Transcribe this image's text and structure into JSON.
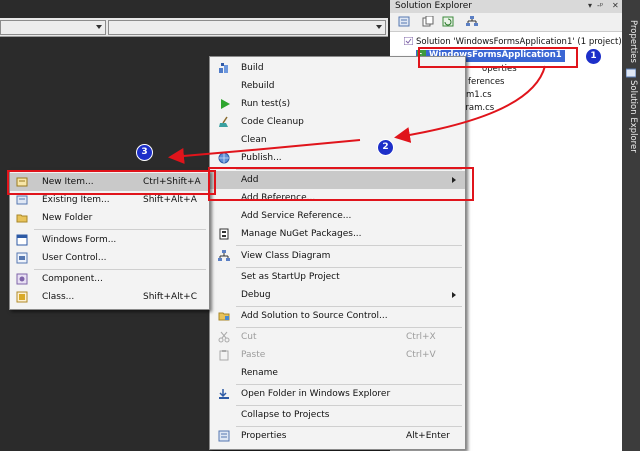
{
  "solution_explorer": {
    "title": "Solution Explorer",
    "title_buttons": [
      "▾",
      "-ᵖ",
      "✕"
    ],
    "tree": [
      {
        "label": "Solution 'WindowsFormsApplication1' (1 project)"
      },
      {
        "label": "WindowsFormsApplication1"
      },
      {
        "label": "operties"
      },
      {
        "label": "ferences"
      },
      {
        "label": "m1.cs"
      },
      {
        "label": "gram.cs"
      }
    ]
  },
  "side_tabs": {
    "properties": "Properties",
    "solution_explorer": "Solution Explorer"
  },
  "context_menu": {
    "items": [
      {
        "label": "Build",
        "shortcut": ""
      },
      {
        "label": "Rebuild",
        "shortcut": ""
      },
      {
        "label": "Run test(s)",
        "shortcut": ""
      },
      {
        "label": "Code Cleanup",
        "shortcut": ""
      },
      {
        "label": "Clean",
        "shortcut": ""
      },
      {
        "label": "Publish...",
        "shortcut": ""
      },
      {
        "label": "Add",
        "shortcut": ""
      },
      {
        "label": "Add Reference...",
        "shortcut": ""
      },
      {
        "label": "Add Service Reference...",
        "shortcut": ""
      },
      {
        "label": "Manage NuGet Packages...",
        "shortcut": ""
      },
      {
        "label": "View Class Diagram",
        "shortcut": ""
      },
      {
        "label": "Set as StartUp Project",
        "shortcut": ""
      },
      {
        "label": "Debug",
        "shortcut": ""
      },
      {
        "label": "Add Solution to Source Control...",
        "shortcut": ""
      },
      {
        "label": "Cut",
        "shortcut": "Ctrl+X"
      },
      {
        "label": "Paste",
        "shortcut": "Ctrl+V"
      },
      {
        "label": "Rename",
        "shortcut": ""
      },
      {
        "label": "Open Folder in Windows Explorer",
        "shortcut": ""
      },
      {
        "label": "Collapse to Projects",
        "shortcut": ""
      },
      {
        "label": "Properties",
        "shortcut": "Alt+Enter"
      }
    ]
  },
  "add_submenu": {
    "items": [
      {
        "label": "New Item...",
        "shortcut": "Ctrl+Shift+A"
      },
      {
        "label": "Existing Item...",
        "shortcut": "Shift+Alt+A"
      },
      {
        "label": "New Folder",
        "shortcut": ""
      },
      {
        "label": "Windows Form...",
        "shortcut": ""
      },
      {
        "label": "User Control...",
        "shortcut": ""
      },
      {
        "label": "Component...",
        "shortcut": ""
      },
      {
        "label": "Class...",
        "shortcut": "Shift+Alt+C"
      }
    ]
  },
  "annotations": {
    "step1": "1",
    "step2": "2",
    "step3": "3"
  },
  "colors": {
    "annotation_red": "#e0141b",
    "badge_blue": "#1d2fc9",
    "selection_blue": "#3a66d4"
  }
}
